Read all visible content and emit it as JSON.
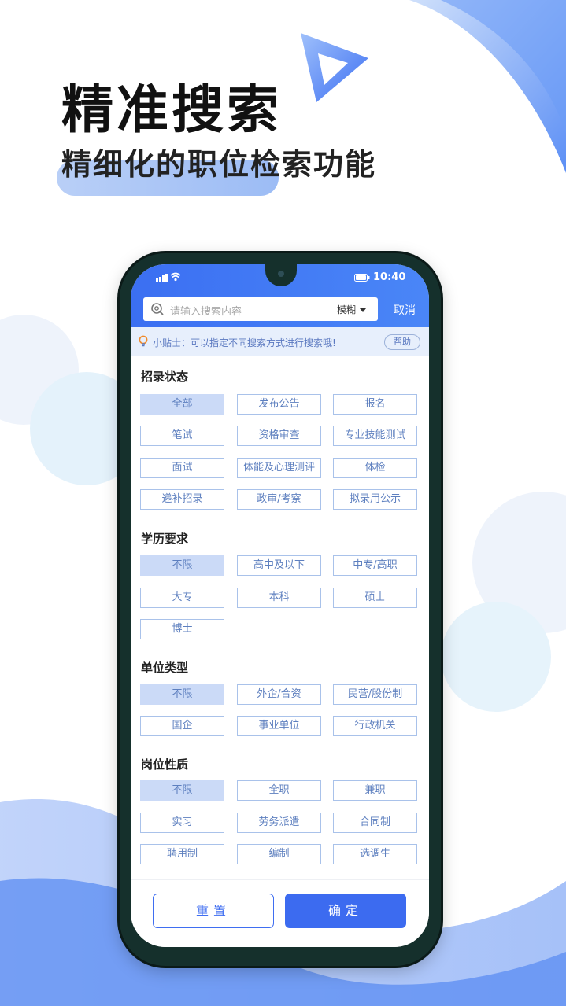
{
  "hero": {
    "title": "精准搜索",
    "subtitle": "精细化的职位检索功能"
  },
  "status_bar": {
    "time": "10:40"
  },
  "search": {
    "placeholder": "请输入搜索内容",
    "mode": "模糊",
    "cancel": "取消"
  },
  "tip": {
    "text": "小贴士：可以指定不同搜索方式进行搜索哦!",
    "help": "帮助"
  },
  "sections": [
    {
      "title": "招录状态",
      "options": [
        "全部",
        "发布公告",
        "报名",
        "笔试",
        "资格审查",
        "专业技能测试",
        "面试",
        "体能及心理测评",
        "体检",
        "递补招录",
        "政审/考察",
        "拟录用公示"
      ],
      "selected": 0
    },
    {
      "title": "学历要求",
      "options": [
        "不限",
        "高中及以下",
        "中专/高职",
        "大专",
        "本科",
        "硕士",
        "博士"
      ],
      "selected": 0
    },
    {
      "title": "单位类型",
      "options": [
        "不限",
        "外企/合资",
        "民营/股份制",
        "国企",
        "事业单位",
        "行政机关"
      ],
      "selected": 0
    },
    {
      "title": "岗位性质",
      "options": [
        "不限",
        "全职",
        "兼职",
        "实习",
        "劳务派遣",
        "合同制",
        "聘用制",
        "编制",
        "选调生"
      ],
      "selected": 0
    }
  ],
  "footer": {
    "reset": "重置",
    "confirm": "确定"
  },
  "colors": {
    "accent": "#3c6bf0",
    "option_border": "#a9c2ea",
    "option_selected": "#cbdaf7",
    "tip_bg": "#e7effc"
  }
}
